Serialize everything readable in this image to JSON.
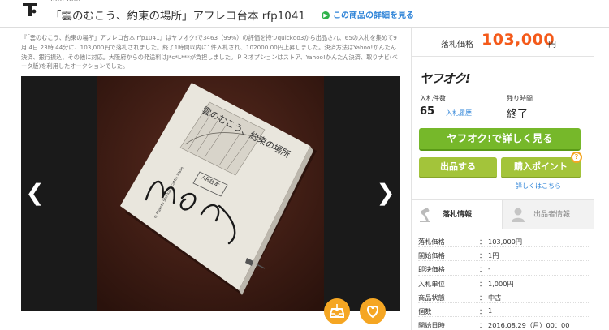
{
  "header": {
    "breadcrumb_cut": "...... ......",
    "title": "「雲のむこう、約束の場所」アフレコ台本 rfp1041",
    "detail_link": "この商品の詳細を見る"
  },
  "description": "『「雲のむこう、約束の場所」アフレコ台本 rfp1041』はヤフオク!で3463（99%）の評価を持つquickdo3から出品され、65の入札を集めて9月 4日 23時 44分に、103,000円で落札されました。終了1時間以内に1件入札され、102000.00円上昇しました。決済方法はYahoo!かんたん決済、銀行振込、その他に対応。大阪府からの発送料はJ*c*L***が負担しました。ＰＲオプションはストア、Yahoo!かんたん決済、取りナビ(ベータ版)を利用したオークションでした。",
  "photo": {
    "book_title": "雲のむこう、約束の場所",
    "book_label": "AR台本",
    "book_credit": "© Makoto Shinkai / CoMix Wave"
  },
  "viewer": {
    "prev_glyph": "❮",
    "next_glyph": "❯"
  },
  "price": {
    "label": "落札価格",
    "value": "103,000",
    "unit": "円"
  },
  "brand": "ヤフオク!",
  "stats": {
    "bids_label": "入札件数",
    "bids_value": "65",
    "history_link": "入札履歴",
    "time_label": "残り時間",
    "time_value": "終了"
  },
  "buttons": {
    "main": "ヤフオク!で詳しく見る",
    "bid": "出品する",
    "point": "購入ポイント",
    "help": "?",
    "more": "詳しくはこちら"
  },
  "tabs": [
    {
      "label": "落札情報"
    },
    {
      "label": "出品者情報"
    }
  ],
  "info_rows": [
    {
      "key": "落札価格",
      "value": "103,000円"
    },
    {
      "key": "開始価格",
      "value": "1円"
    },
    {
      "key": "即決価格",
      "value": "-"
    },
    {
      "key": "入札単位",
      "value": "1,000円"
    },
    {
      "key": "商品状態",
      "value": "中古"
    },
    {
      "key": "個数",
      "value": "1"
    },
    {
      "key": "開始日時",
      "value": "2016.08.29（月）00：00"
    }
  ],
  "colors": {
    "accent_price": "#f45a1a",
    "button_green": "#76b82a",
    "link_blue": "#2f84d8",
    "orange_round": "#f5a623"
  }
}
